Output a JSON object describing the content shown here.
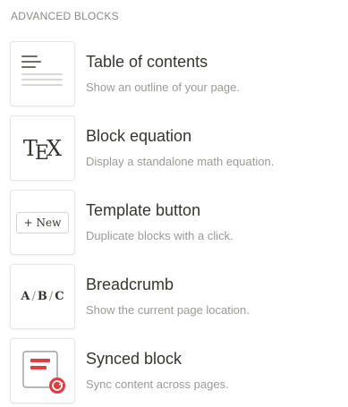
{
  "section": {
    "title": "ADVANCED BLOCKS"
  },
  "items": [
    {
      "key": "table-of-contents",
      "title": "Table of contents",
      "description": "Show an outline of your page.",
      "icon": "table-of-contents-icon"
    },
    {
      "key": "block-equation",
      "title": "Block equation",
      "description": "Display a standalone math equation.",
      "icon": "tex-icon",
      "thumb_text": {
        "t": "T",
        "e": "E",
        "x": "X"
      }
    },
    {
      "key": "template-button",
      "title": "Template button",
      "description": "Duplicate blocks with a click.",
      "icon": "new-button-icon",
      "thumb_text": "+ New"
    },
    {
      "key": "breadcrumb",
      "title": "Breadcrumb",
      "description": "Show the current page location.",
      "icon": "breadcrumb-icon",
      "thumb_text": {
        "a": "A",
        "b": "B",
        "c": "C",
        "sep": "/"
      }
    },
    {
      "key": "synced-block",
      "title": "Synced block",
      "description": "Sync content across pages.",
      "icon": "synced-block-icon"
    }
  ],
  "colors": {
    "accent_red": "#e03e3e",
    "text_primary": "#37352f",
    "text_secondary": "#9b9a97",
    "header_text": "#8b8a86"
  }
}
